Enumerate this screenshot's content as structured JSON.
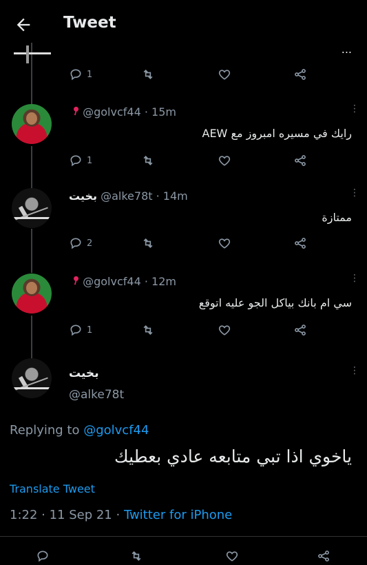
{
  "header": {
    "title": "Tweet"
  },
  "top_partial": {
    "text": "..."
  },
  "replies": [
    {
      "display_name": "",
      "handle": "@golvcf44",
      "time": "15m",
      "text": "رايك في مسيره امبروز مع AEW",
      "reply_count": "1",
      "avatar": "liverpool-player-avatar"
    },
    {
      "display_name": "بخيت",
      "handle": "@alke78t",
      "time": "14m",
      "text": "ممتازة",
      "reply_count": "2",
      "avatar": "speaker-avatar"
    },
    {
      "display_name": "",
      "handle": "@golvcf44",
      "time": "12m",
      "text": "سي ام بانك بياكل الجو عليه اتوقع",
      "reply_count": "1",
      "avatar": "liverpool-player-avatar"
    }
  ],
  "first_actions": {
    "reply_count": "1"
  },
  "main_tweet": {
    "display_name": "بخيت",
    "handle": "@alke78t",
    "replying_prefix": "Replying to",
    "replying_to": "@golvcf44",
    "text": "ياخوي اذا تبي متابعه عادي بعطيك",
    "translate_label": "Translate Tweet",
    "timestamp": "1:22 · 11 Sep 21 · ",
    "source": "Twitter for iPhone"
  },
  "colors": {
    "accent": "#1d9bf0",
    "muted": "#8b98a5",
    "background": "#000000"
  }
}
